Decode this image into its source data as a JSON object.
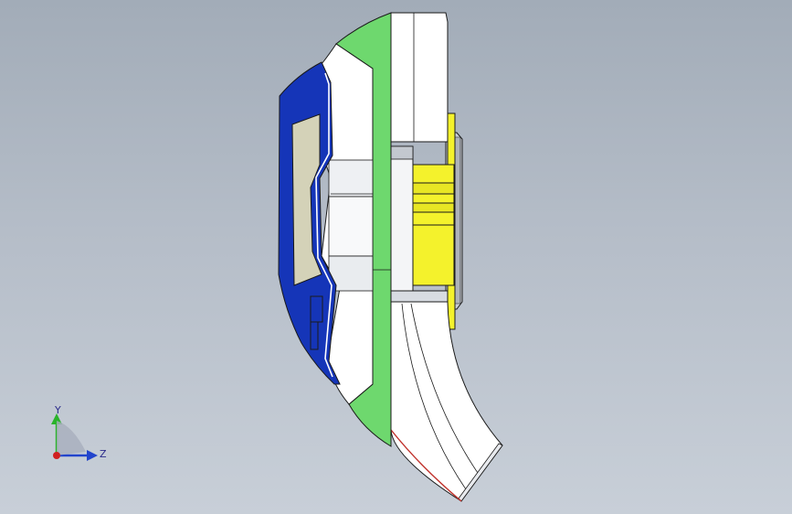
{
  "window": {
    "type": "cad-graphics-viewport",
    "background_top": "#a2acb8",
    "background_bottom": "#c8cfd8"
  },
  "model": {
    "description_colors": {
      "blue": "#1535b8",
      "green": "#6ed86e",
      "yellow": "#f4f22c",
      "beige": "#d4d2b8",
      "white": "#ffffff",
      "gray": "#c9cdd4",
      "edge": "#1a1a1a",
      "red_edge": "#c0302a"
    }
  },
  "triad": {
    "y_label": "Y",
    "z_label": "Z",
    "y_color": "#2ab32a",
    "z_color": "#2244cc",
    "x_color": "#d02020"
  }
}
